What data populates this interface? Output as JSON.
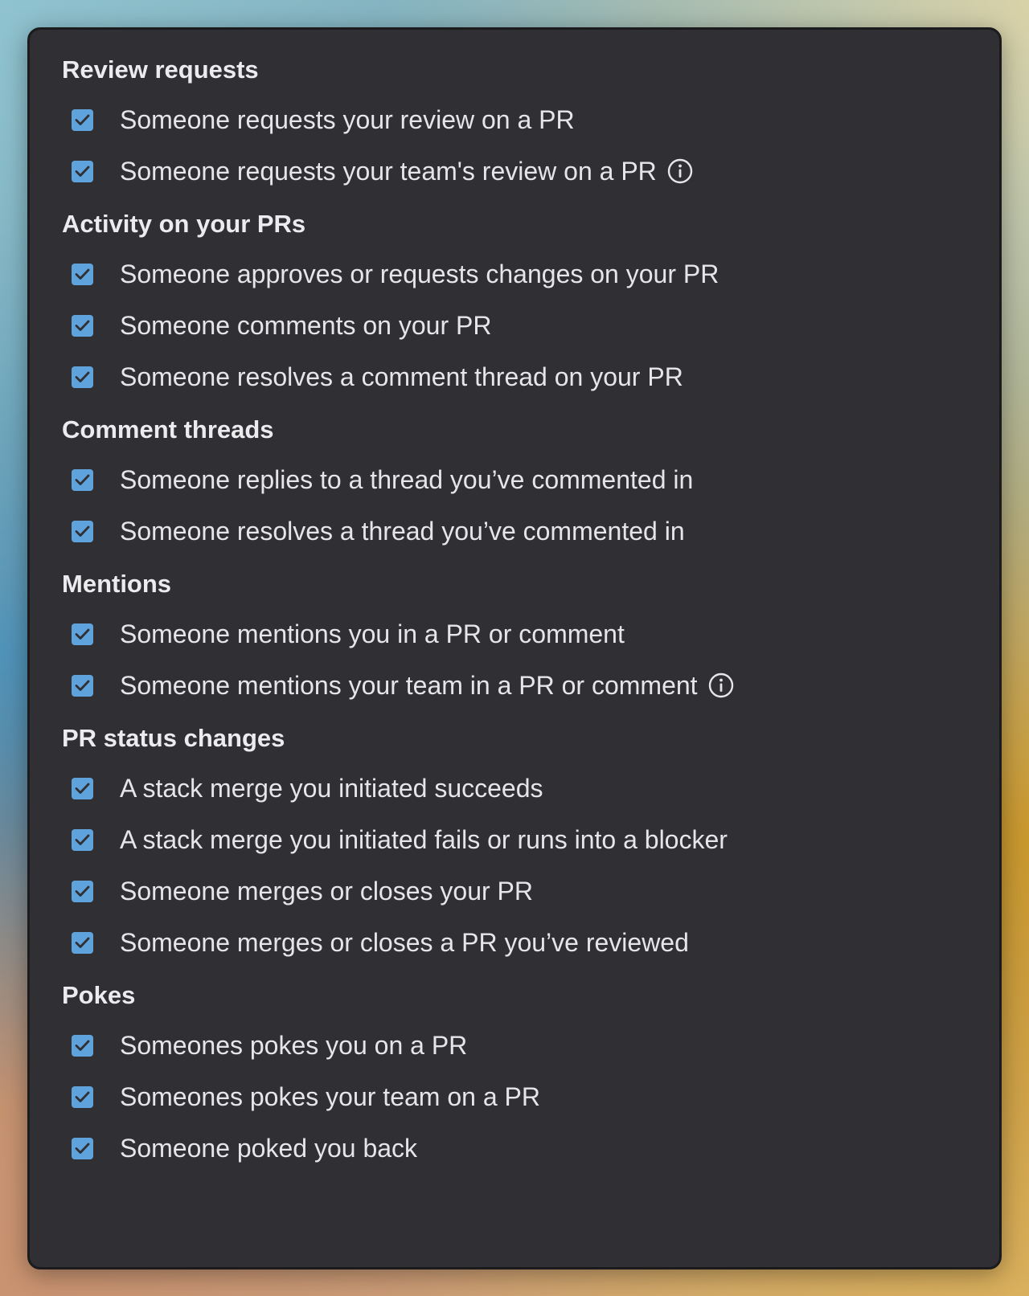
{
  "sections": [
    {
      "title": "Review requests",
      "items": [
        {
          "label": "Someone requests your review on a PR",
          "checked": true,
          "info": false
        },
        {
          "label": "Someone requests your team's review on a PR",
          "checked": true,
          "info": true
        }
      ]
    },
    {
      "title": "Activity on your PRs",
      "items": [
        {
          "label": "Someone approves or requests changes on your PR",
          "checked": true,
          "info": false
        },
        {
          "label": "Someone comments on your PR",
          "checked": true,
          "info": false
        },
        {
          "label": "Someone resolves a comment thread on your PR",
          "checked": true,
          "info": false
        }
      ]
    },
    {
      "title": "Comment threads",
      "items": [
        {
          "label": "Someone replies to a thread you’ve commented in",
          "checked": true,
          "info": false
        },
        {
          "label": "Someone resolves a thread you’ve commented in",
          "checked": true,
          "info": false
        }
      ]
    },
    {
      "title": "Mentions",
      "items": [
        {
          "label": "Someone mentions you in a PR or comment",
          "checked": true,
          "info": false
        },
        {
          "label": "Someone mentions your team in a PR or comment",
          "checked": true,
          "info": true
        }
      ]
    },
    {
      "title": "PR status changes",
      "items": [
        {
          "label": "A stack merge you initiated succeeds",
          "checked": true,
          "info": false
        },
        {
          "label": "A stack merge you initiated fails or runs into a blocker",
          "checked": true,
          "info": false
        },
        {
          "label": "Someone merges or closes your PR",
          "checked": true,
          "info": false
        },
        {
          "label": "Someone merges or closes a PR you’ve reviewed",
          "checked": true,
          "info": false
        }
      ]
    },
    {
      "title": "Pokes",
      "items": [
        {
          "label": "Someones pokes you on a PR",
          "checked": true,
          "info": false
        },
        {
          "label": "Someones pokes your team on a PR",
          "checked": true,
          "info": false
        },
        {
          "label": "Someone poked you back",
          "checked": true,
          "info": false
        }
      ]
    }
  ],
  "colors": {
    "panel_background": "#2f2f34",
    "checkbox_accent": "#5fa3dd",
    "text": "#e6e6e9"
  },
  "icons": {
    "checkbox": "check-icon",
    "info": "info-icon"
  }
}
